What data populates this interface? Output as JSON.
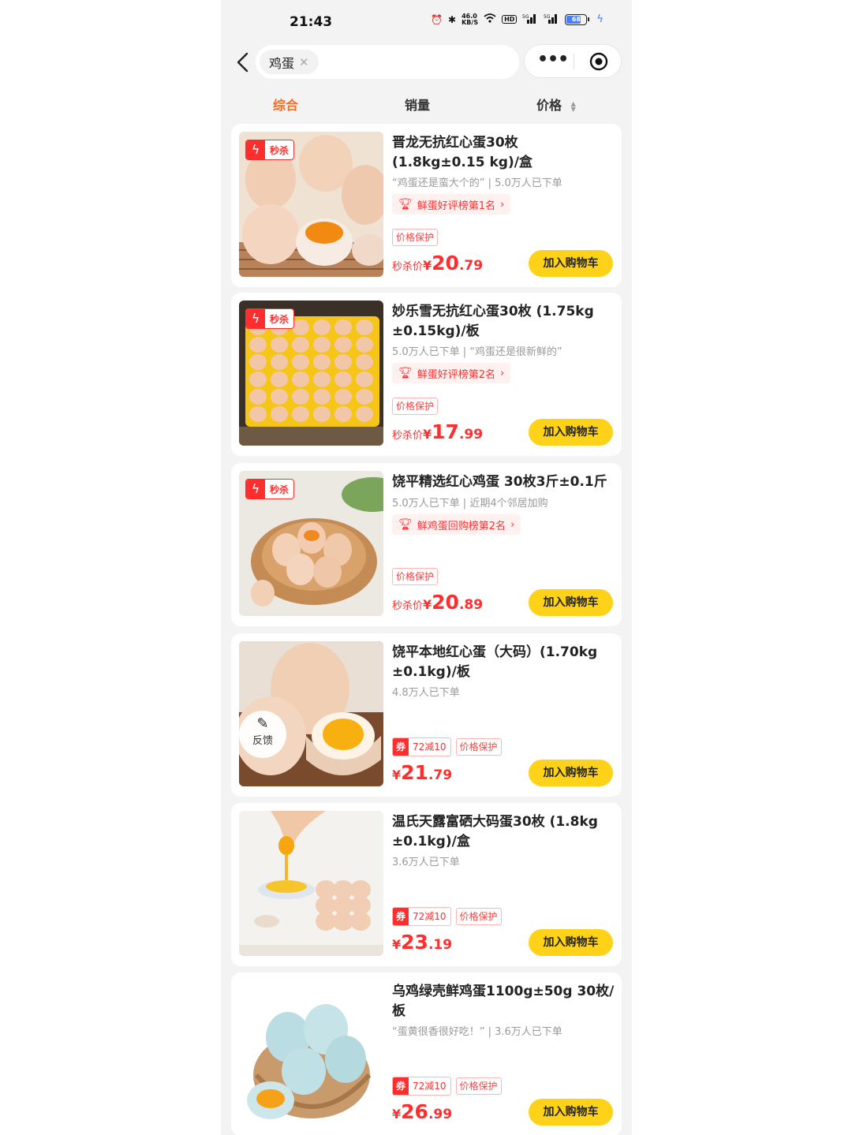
{
  "status_bar": {
    "time": "21:43",
    "network_speed": "46.0\nKB/S",
    "hd": "HD",
    "battery": "68"
  },
  "search": {
    "query": "鸡蛋"
  },
  "tabs": [
    {
      "label": "综合",
      "active": true
    },
    {
      "label": "销量",
      "active": false
    },
    {
      "label": "价格",
      "active": false
    }
  ],
  "products": [
    {
      "flash_label": "秒杀",
      "title": "晋龙无抗红心蛋30枚 (1.8kg±0.15 kg)/盒",
      "sub": "“鸡蛋还是蛮大个的” | 5.0万人已下单",
      "rank": "鲜蛋好评榜第1名",
      "tags": [
        "价格保护"
      ],
      "price_prefix": "秒杀价",
      "currency": "¥",
      "price_int": "20",
      "price_dec": ".79",
      "cart_label": "加入购物车",
      "image": "eggs-basket"
    },
    {
      "flash_label": "秒杀",
      "title": "妙乐雪无抗红心蛋30枚 (1.75kg ±0.15kg)/板",
      "sub": "5.0万人已下单 | “鸡蛋还是很新鲜的”",
      "rank": "鲜蛋好评榜第2名",
      "tags": [
        "价格保护"
      ],
      "price_prefix": "秒杀价",
      "currency": "¥",
      "price_int": "17",
      "price_dec": ".99",
      "cart_label": "加入购物车",
      "image": "egg-tray"
    },
    {
      "flash_label": "秒杀",
      "title": "饶平精选红心鸡蛋 30枚3斤±0.1斤",
      "sub": "5.0万人已下单 | 近期4个邻居加购",
      "rank": "鲜鸡蛋回购榜第2名",
      "tags": [
        "价格保护"
      ],
      "price_prefix": "秒杀价",
      "currency": "¥",
      "price_int": "20",
      "price_dec": ".89",
      "cart_label": "加入购物车",
      "image": "wood-bowl"
    },
    {
      "title": "饶平本地红心蛋（大码）(1.70kg ±0.1kg)/板",
      "sub": "4.8万人已下单",
      "coupon_mark": "券",
      "coupon_text": "72减10",
      "tags": [
        "价格保护"
      ],
      "currency": "¥",
      "price_int": "21",
      "price_dec": ".79",
      "cart_label": "加入购物车",
      "feedback_label": "反馈",
      "image": "cracked-egg"
    },
    {
      "title": "温氏天露富硒大码蛋30枚 (1.8kg ±0.1kg)/盒",
      "sub": "3.6万人已下单",
      "coupon_mark": "券",
      "coupon_text": "72减10",
      "tags": [
        "价格保护"
      ],
      "currency": "¥",
      "price_int": "23",
      "price_dec": ".19",
      "cart_label": "加入购物车",
      "image": "yolk-pour"
    },
    {
      "title": "乌鸡绿壳鲜鸡蛋1100g±50g 30枚/板",
      "sub": "“蛋黄很香很好吃！” | 3.6万人已下单",
      "coupon_mark": "券",
      "coupon_text": "72减10",
      "tags": [
        "价格保护"
      ],
      "currency": "¥",
      "price_int": "26",
      "price_dec": ".99",
      "cart_label": "加入购物车",
      "image": "green-eggs"
    }
  ],
  "colors": {
    "accent": "#ff6a1a",
    "price_red": "#ff2e2e",
    "cart_yellow": "#ffd21a"
  }
}
